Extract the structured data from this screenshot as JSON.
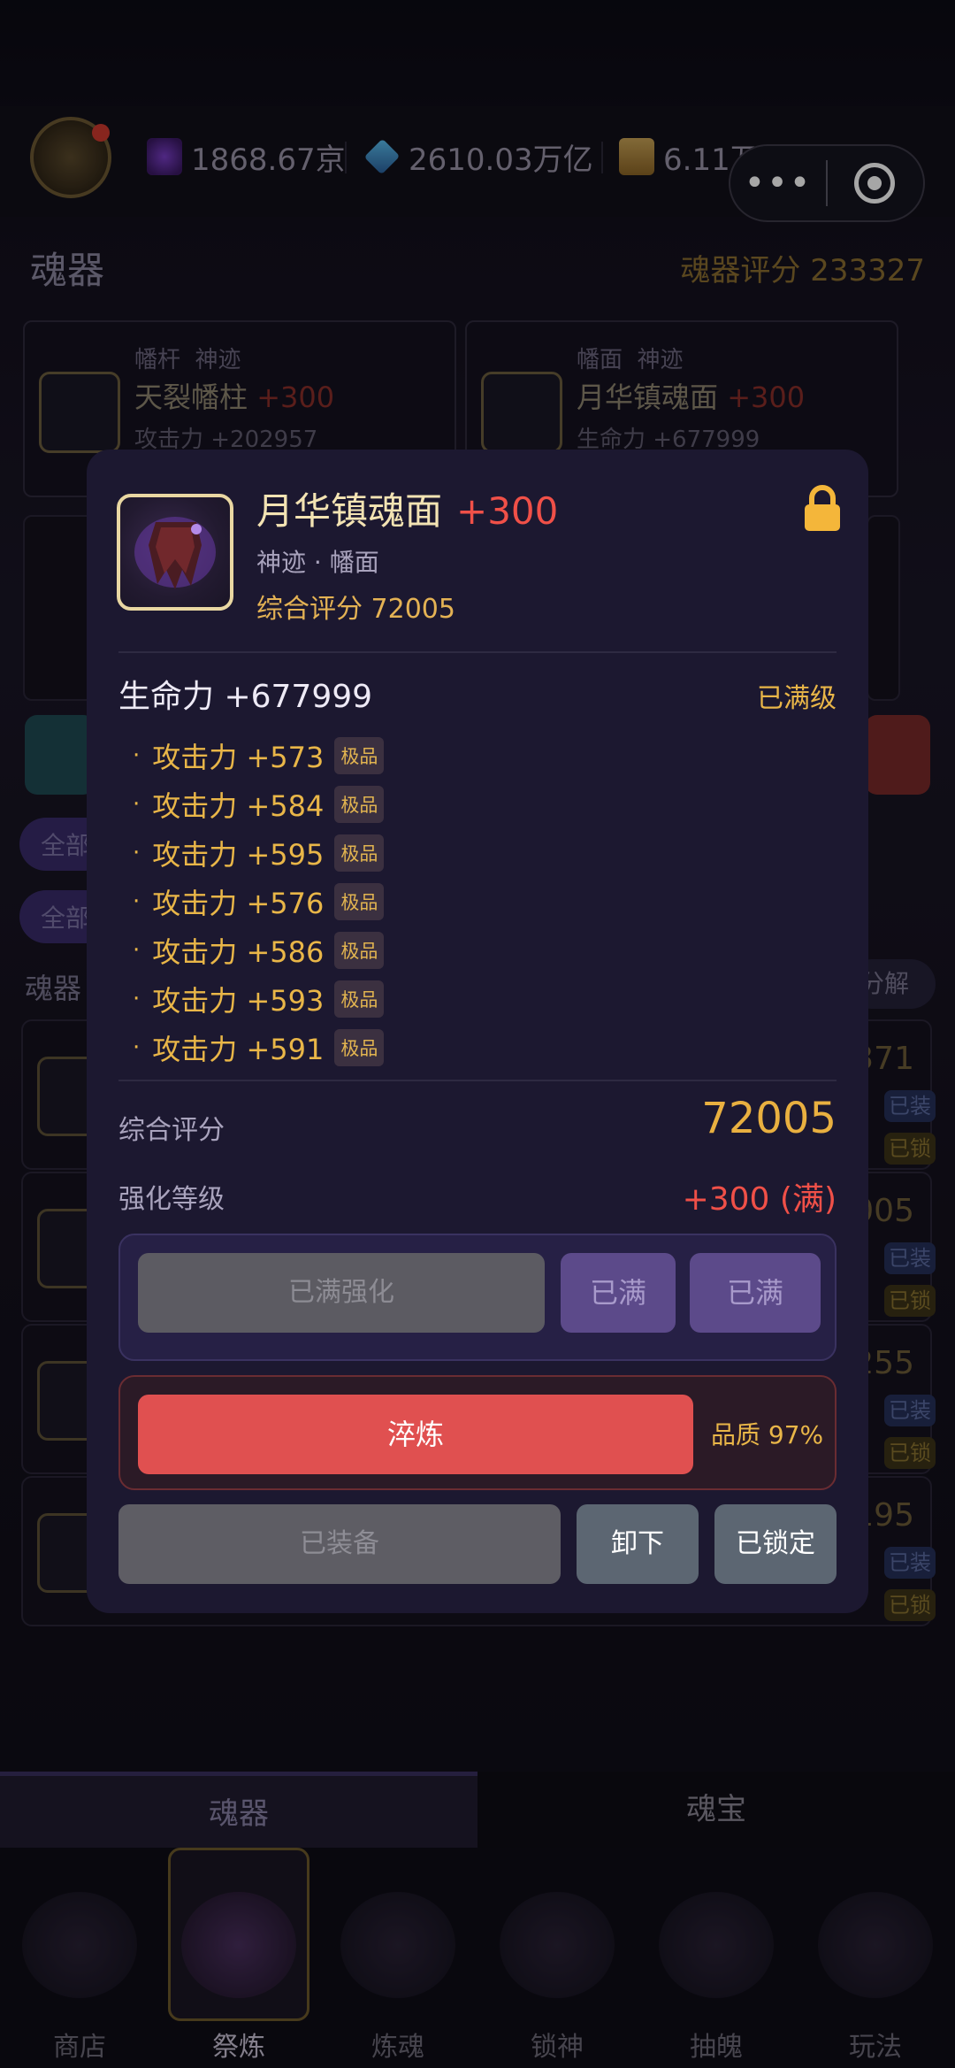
{
  "topbar": {
    "resources": [
      {
        "value": "1868.67京",
        "icon": "purple-gem-icon"
      },
      {
        "value": "2610.03万亿",
        "icon": "blue-crystal-icon"
      },
      {
        "value": "6.11万",
        "icon": "scroll-icon"
      }
    ],
    "capsule": {
      "menu": "•••"
    }
  },
  "section": {
    "title": "魂器",
    "score": "魂器评分 233327"
  },
  "cards": [
    {
      "type": "幡杆",
      "rank": "神迹",
      "name": "天裂幡柱",
      "plus": "+300",
      "stat": "攻击力 +202957"
    },
    {
      "type": "幡面",
      "rank": "神迹",
      "name": "月华镇魂面",
      "plus": "+300",
      "stat": "生命力 +677999"
    }
  ],
  "filters": {
    "all1": "全部",
    "all2": "全部",
    "list_title": "魂器",
    "decompose": "分解"
  },
  "list_right": {
    "nums": [
      "371",
      "005",
      "255",
      "195"
    ],
    "equipped": "已装",
    "locked": "已锁"
  },
  "modal": {
    "name": "月华镇魂面",
    "plus": "+300",
    "subtitle": "神迹 · 幡面",
    "score_line": "综合评分 72005",
    "main_stat": "生命力 +677999",
    "max_level": "已满级",
    "substats": [
      {
        "text": "攻击力 +573",
        "badge": "极品"
      },
      {
        "text": "攻击力 +584",
        "badge": "极品"
      },
      {
        "text": "攻击力 +595",
        "badge": "极品"
      },
      {
        "text": "攻击力 +576",
        "badge": "极品"
      },
      {
        "text": "攻击力 +586",
        "badge": "极品"
      },
      {
        "text": "攻击力 +593",
        "badge": "极品"
      },
      {
        "text": "攻击力 +591",
        "badge": "极品"
      }
    ],
    "score_label": "综合评分",
    "score_value": "72005",
    "level_label": "强化等级",
    "level_value": "+300 (满)",
    "btn_max_enhance": "已满强化",
    "btn_full_1": "已满",
    "btn_full_2": "已满",
    "btn_refine": "淬炼",
    "quality": "品质 97%",
    "btn_equipped": "已装备",
    "btn_unequip": "卸下",
    "btn_locked": "已锁定"
  },
  "tabs": [
    "魂器",
    "魂宝"
  ],
  "bottom_nav": [
    "商店",
    "祭炼",
    "炼魂",
    "锁神",
    "抽魄",
    "玩法"
  ]
}
